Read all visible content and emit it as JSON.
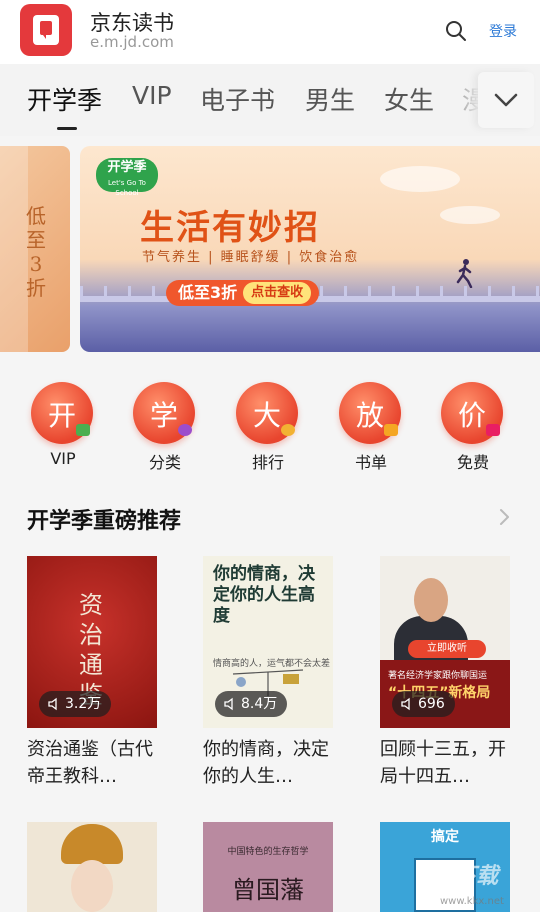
{
  "header": {
    "app_name": "京东读书",
    "domain": "e.m.jd.com",
    "login_label": "登录"
  },
  "tabs": [
    {
      "label": "开学季",
      "active": true
    },
    {
      "label": "VIP"
    },
    {
      "label": "电子书"
    },
    {
      "label": "男生"
    },
    {
      "label": "女生"
    },
    {
      "label": "漫"
    }
  ],
  "banner": {
    "side_text": "低至3折",
    "badge_title": "开学季",
    "badge_sub": "Let's Go To School",
    "title": "生活有妙招",
    "subtitle": "节气养生 | 睡眠舒缓 | 饮食治愈",
    "discount": "低至3折",
    "cta": "点击查收"
  },
  "categories": [
    {
      "char": "开",
      "label": "VIP"
    },
    {
      "char": "学",
      "label": "分类"
    },
    {
      "char": "大",
      "label": "排行"
    },
    {
      "char": "放",
      "label": "书单"
    },
    {
      "char": "价",
      "label": "免费"
    }
  ],
  "section": {
    "title": "开学季重磅推荐"
  },
  "books": [
    {
      "title": "资治通鉴（古代帝王教科…",
      "plays": "3.2万",
      "cover_text": "资治通鉴"
    },
    {
      "title": "你的情商，决定你的人生…",
      "plays": "8.4万",
      "cover_text": "你的情商，决定你的人生高度",
      "cover_sub": "情商高的人，运气都不会太差"
    },
    {
      "title": "回顾十三五，开局十四五…",
      "plays": "696",
      "cover_btn": "立即收听",
      "cover_band": "著名经济学家跟你聊国运",
      "cover_band_big": "“十四五”新格局"
    }
  ],
  "row2": {
    "b2_small": "中国特色的生存哲学",
    "b2_big": "曾国藩",
    "b3_title": "搞定"
  },
  "watermark": {
    "text": "KK下载",
    "url": "www.kkx.net"
  },
  "colors": {
    "accent": "#e4393c",
    "link": "#2d7ad6",
    "icon_red": "#e8452e"
  }
}
